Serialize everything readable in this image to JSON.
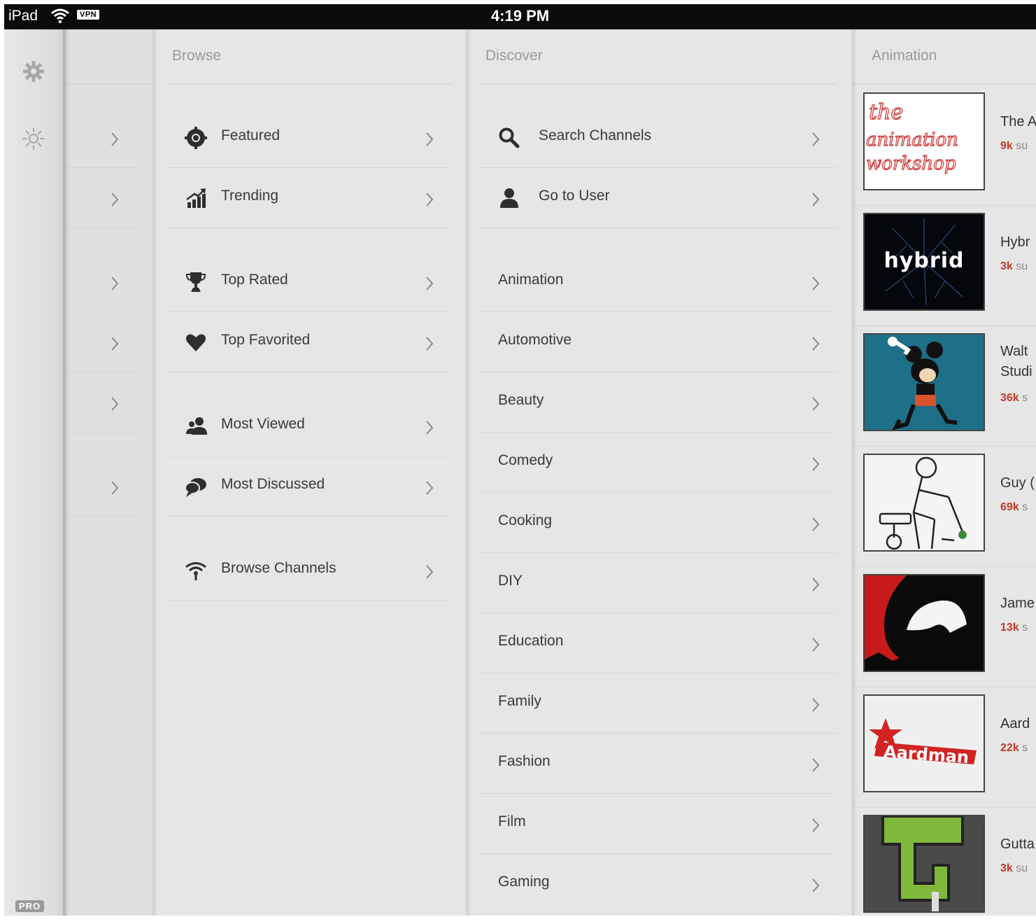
{
  "status_bar": {
    "carrier": "iPad",
    "vpn": "VPN",
    "time": "4:19 PM"
  },
  "rail": {
    "icons": [
      "gear-icon",
      "brightness-icon"
    ],
    "badge": "PRO"
  },
  "browse": {
    "title": "Browse",
    "items": [
      {
        "label": "Featured",
        "icon": "featured-icon"
      },
      {
        "label": "Trending",
        "icon": "trending-icon"
      },
      {
        "label": "Top Rated",
        "icon": "trophy-icon"
      },
      {
        "label": "Top Favorited",
        "icon": "heart-icon"
      },
      {
        "label": "Most Viewed",
        "icon": "users-icon"
      },
      {
        "label": "Most Discussed",
        "icon": "chat-icon"
      },
      {
        "label": "Browse Channels",
        "icon": "broadcast-icon"
      }
    ]
  },
  "discover": {
    "title": "Discover",
    "actions": [
      {
        "label": "Search Channels",
        "icon": "search-icon"
      },
      {
        "label": "Go to User",
        "icon": "user-icon"
      }
    ],
    "categories": [
      "Animation",
      "Automotive",
      "Beauty",
      "Comedy",
      "Cooking",
      "DIY",
      "Education",
      "Family",
      "Fashion",
      "Film",
      "Gaming"
    ]
  },
  "animation": {
    "title": "Animation",
    "channels": [
      {
        "name": "The A",
        "subs": "9k",
        "subs_rest": " su"
      },
      {
        "name": "Hybr",
        "subs": "3k",
        "subs_rest": " su"
      },
      {
        "name": "Walt",
        "name_line2": "Studi",
        "subs": "36k",
        "subs_rest": " s"
      },
      {
        "name": "Guy (",
        "subs": "69k",
        "subs_rest": " s"
      },
      {
        "name": "Jame",
        "subs": "13k",
        "subs_rest": " s"
      },
      {
        "name": "Aard",
        "subs": "22k",
        "subs_rest": " s"
      },
      {
        "name": "Gutta",
        "subs": "3k",
        "subs_rest": " su"
      }
    ],
    "thumb_texts": [
      "the animation workshop",
      "hybrid",
      "Aardman"
    ]
  },
  "colors": {
    "subs_accent": "#c0392b",
    "status_bar": "#0b0b0b",
    "panel_bg": "#e6e6e6"
  }
}
